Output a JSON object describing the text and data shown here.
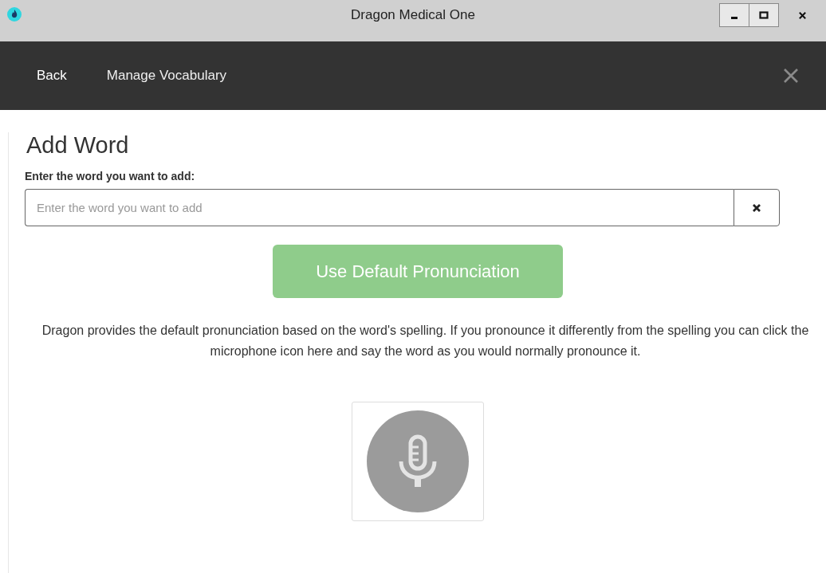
{
  "window": {
    "title": "Dragon Medical One"
  },
  "nav": {
    "back": "Back",
    "title": "Manage Vocabulary"
  },
  "page": {
    "heading": "Add Word",
    "field_label": "Enter the word you want to add:",
    "field": {
      "placeholder": "Enter the word you want to add"
    },
    "default_button": {
      "label": "Use Default Pronunciation",
      "disabled": true
    },
    "description": "Dragon provides the default pronunciation based on the word's spelling. If you pronounce it differently from the spelling you can click the microphone icon here and say the word as you would normally pronounce it.",
    "microphone": {
      "disabled": true
    }
  }
}
